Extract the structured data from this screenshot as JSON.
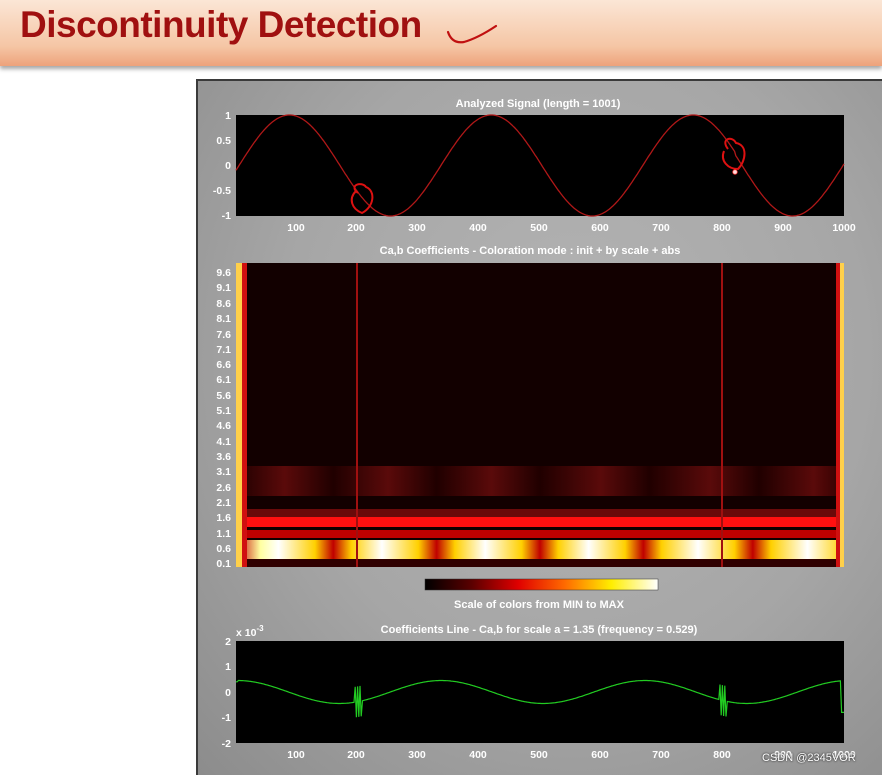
{
  "header": {
    "title": "Discontinuity Detection"
  },
  "figure": {
    "signal_plot": {
      "title": "Analyzed Signal  (length = 1001)",
      "y_ticks": [
        "1",
        "0.5",
        "0",
        "-0.5",
        "-1"
      ],
      "x_ticks": [
        "100",
        "200",
        "300",
        "400",
        "500",
        "600",
        "700",
        "800",
        "900",
        "1000"
      ]
    },
    "coef_plot": {
      "title": "Ca,b Coefficients  - Coloration mode : init + by scale + abs",
      "y_ticks": [
        "9.6",
        "9.1",
        "8.6",
        "8.1",
        "7.6",
        "7.1",
        "6.6",
        "6.1",
        "5.6",
        "5.1",
        "4.6",
        "4.1",
        "3.6",
        "3.1",
        "2.6",
        "2.1",
        "1.6",
        "1.1",
        "0.6",
        "0.1"
      ]
    },
    "colorbar": {
      "label": "Scale of colors from MIN to MAX"
    },
    "line_plot": {
      "title": "Coefficients Line - Ca,b   for scale a = 1.35  (frequency =   0.529)",
      "exponent": "x 10",
      "exponent_power": "-3",
      "y_ticks": [
        "2",
        "1",
        "0",
        "-1",
        "-2"
      ],
      "x_ticks": [
        "100",
        "200",
        "300",
        "400",
        "500",
        "600",
        "700",
        "800",
        "900",
        "1000"
      ]
    }
  },
  "watermark": "CSDN @2345VOR",
  "colors": {
    "header_title": "#a01010",
    "signal": "#b01818",
    "coef_line": "#22cc22",
    "annotation": "#dd1111"
  }
}
